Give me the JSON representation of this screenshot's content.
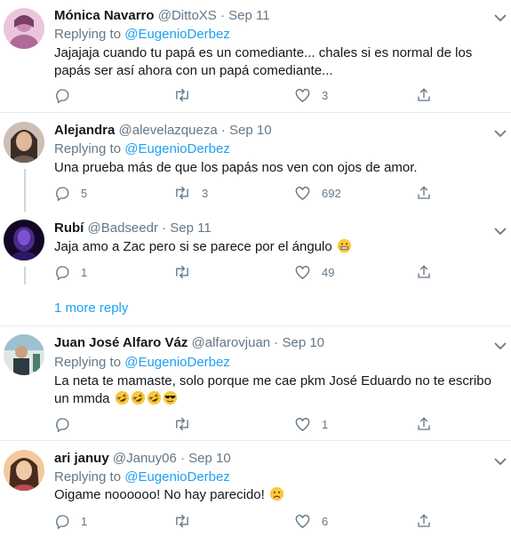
{
  "tweets": [
    {
      "name": "Mónica Navarro",
      "handle": "@DittoXS",
      "date": "Sep 11",
      "replying_label": "Replying to",
      "replying_to": "@EugenioDerbez",
      "text": "Jajajaja cuando tu papá es un comediante... chales si es normal de los papás ser así ahora con un papá comediante...",
      "replies": "",
      "retweets": "",
      "likes": "3",
      "avatar_color": "#c98bb3"
    },
    {
      "name": "Alejandra",
      "handle": "@alevelazqueza",
      "date": "Sep 10",
      "replying_label": "Replying to",
      "replying_to": "@EugenioDerbez",
      "text": "Una prueba más de que los papás nos ven con ojos de amor.",
      "replies": "5",
      "retweets": "3",
      "likes": "692",
      "avatar_color": "#8a7a70"
    },
    {
      "name": "Rubí",
      "handle": "@Badseedr",
      "date": "Sep 11",
      "text": "Jaja amo a Zac pero si se parece por el ángulo",
      "emojis": [
        "grimacing-face-emoji"
      ],
      "replies": "1",
      "retweets": "",
      "likes": "49",
      "avatar_color": "#2a1250"
    },
    {
      "name": "Juan José Alfaro Váz",
      "handle": "@alfarovjuan",
      "date": "Sep 10",
      "replying_label": "Replying to",
      "replying_to": "@EugenioDerbez",
      "text": "La neta te mamaste, solo porque me cae pkm José Eduardo no te escribo un mmda",
      "emojis": [
        "rofl-emoji",
        "rofl-emoji",
        "rofl-emoji",
        "sunglasses-emoji"
      ],
      "replies": "",
      "retweets": "",
      "likes": "1",
      "avatar_color": "#5e8aa0"
    },
    {
      "name": "ari januy",
      "handle": "@Januy06",
      "date": "Sep 10",
      "replying_label": "Replying to",
      "replying_to": "@EugenioDerbez",
      "text": "Oigame noooooo! No hay parecido!",
      "emojis": [
        "worried-face-emoji"
      ],
      "replies": "1",
      "retweets": "",
      "likes": "6",
      "avatar_color": "#d9a07a"
    }
  ],
  "more_reply": "1 more reply",
  "colors": {
    "accent": "#1da1f2",
    "muted": "#657786",
    "divider": "#e6ecf0"
  }
}
